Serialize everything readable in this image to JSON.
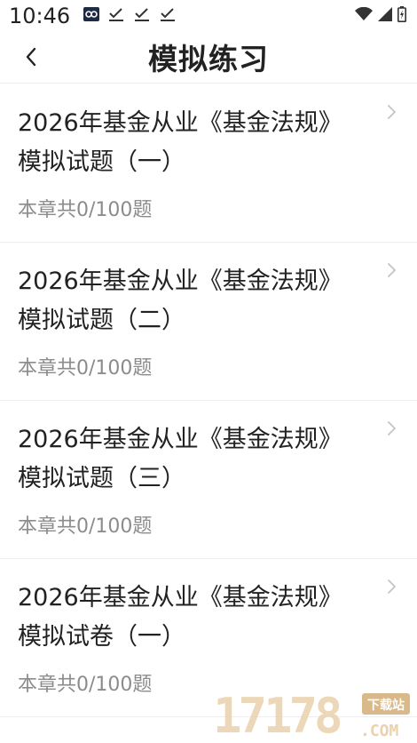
{
  "status_bar": {
    "time": "10:46",
    "notification_icons": [
      "app-badge-icon",
      "check-icon",
      "check-icon",
      "check-icon"
    ],
    "right_icons": [
      "wifi-icon",
      "signal-icon",
      "battery-icon"
    ]
  },
  "header": {
    "back_icon": "chevron-left-icon",
    "title": "模拟练习"
  },
  "items": [
    {
      "title": "2026年基金从业《基金法规》模拟试题（一）",
      "sub": "本章共0/100题"
    },
    {
      "title": "2026年基金从业《基金法规》模拟试题（二）",
      "sub": "本章共0/100题"
    },
    {
      "title": "2026年基金从业《基金法规》模拟试题（三）",
      "sub": "本章共0/100题"
    },
    {
      "title": "2026年基金从业《基金法规》模拟试卷（一）",
      "sub": "本章共0/100题"
    }
  ],
  "watermark": {
    "text": "17178",
    "tag": "下载站",
    "domain": ".COM"
  },
  "colors": {
    "title": "#222222",
    "sub": "#8c8c8c",
    "divider": "#eeeeee",
    "chevron": "#c4c4c4",
    "watermark": "#d9b98a"
  }
}
